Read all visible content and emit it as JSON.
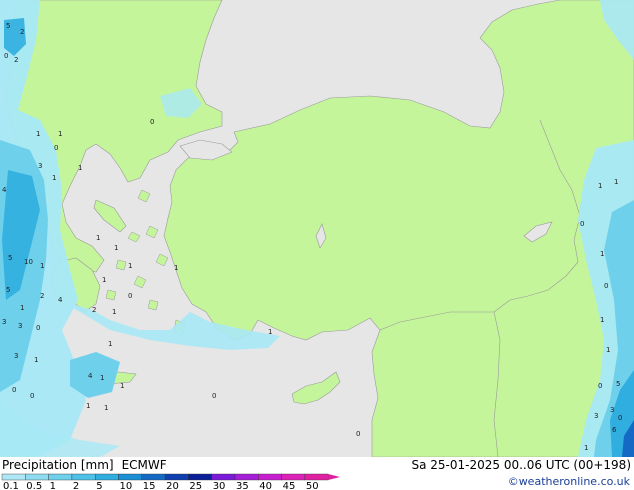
{
  "legend": {
    "label": "Precipitation [mm]",
    "model": "ECMWF",
    "datetime": "Sa 25-01-2025 00..06 UTC (00+198)",
    "credit": "©weatheronline.co.uk"
  },
  "colorbar": {
    "ticks": [
      "0.1",
      "0.5",
      "1",
      "2",
      "5",
      "10",
      "15",
      "20",
      "25",
      "30",
      "35",
      "40",
      "45",
      "50"
    ],
    "colors": [
      "#aee6f4",
      "#8fdcf0",
      "#6fd0ec",
      "#4ec1e6",
      "#30aee0",
      "#1a8fd6",
      "#1469c4",
      "#103fb0",
      "#0b1f96",
      "#7b1ad8",
      "#a51fd8",
      "#c71fd0",
      "#dd22b8",
      "#e020a0"
    ]
  },
  "colors": {
    "sea": "#e6e6e6",
    "land": "#c5f59b",
    "precip_light": "#a8e8f6",
    "precip_medium": "#6fd0ec",
    "precip_heavy": "#30aee0",
    "border": "#9a9a9a"
  },
  "map_values": [
    "5",
    "2",
    "0",
    "2",
    "1",
    "0",
    "3",
    "1",
    "4",
    "5",
    "10",
    "1",
    "5",
    "2",
    "1",
    "4",
    "2",
    "3",
    "1",
    "3",
    "0",
    "3",
    "1",
    "0",
    "1",
    "1",
    "0",
    "1",
    "1",
    "1",
    "1",
    "0",
    "1",
    "1",
    "1",
    "4",
    "1",
    "0",
    "1",
    "1",
    "0",
    "0",
    "1",
    "0",
    "1",
    "0",
    "1",
    "5",
    "0",
    "3",
    "0",
    "3",
    "6",
    "1",
    "1",
    "1",
    "1"
  ]
}
